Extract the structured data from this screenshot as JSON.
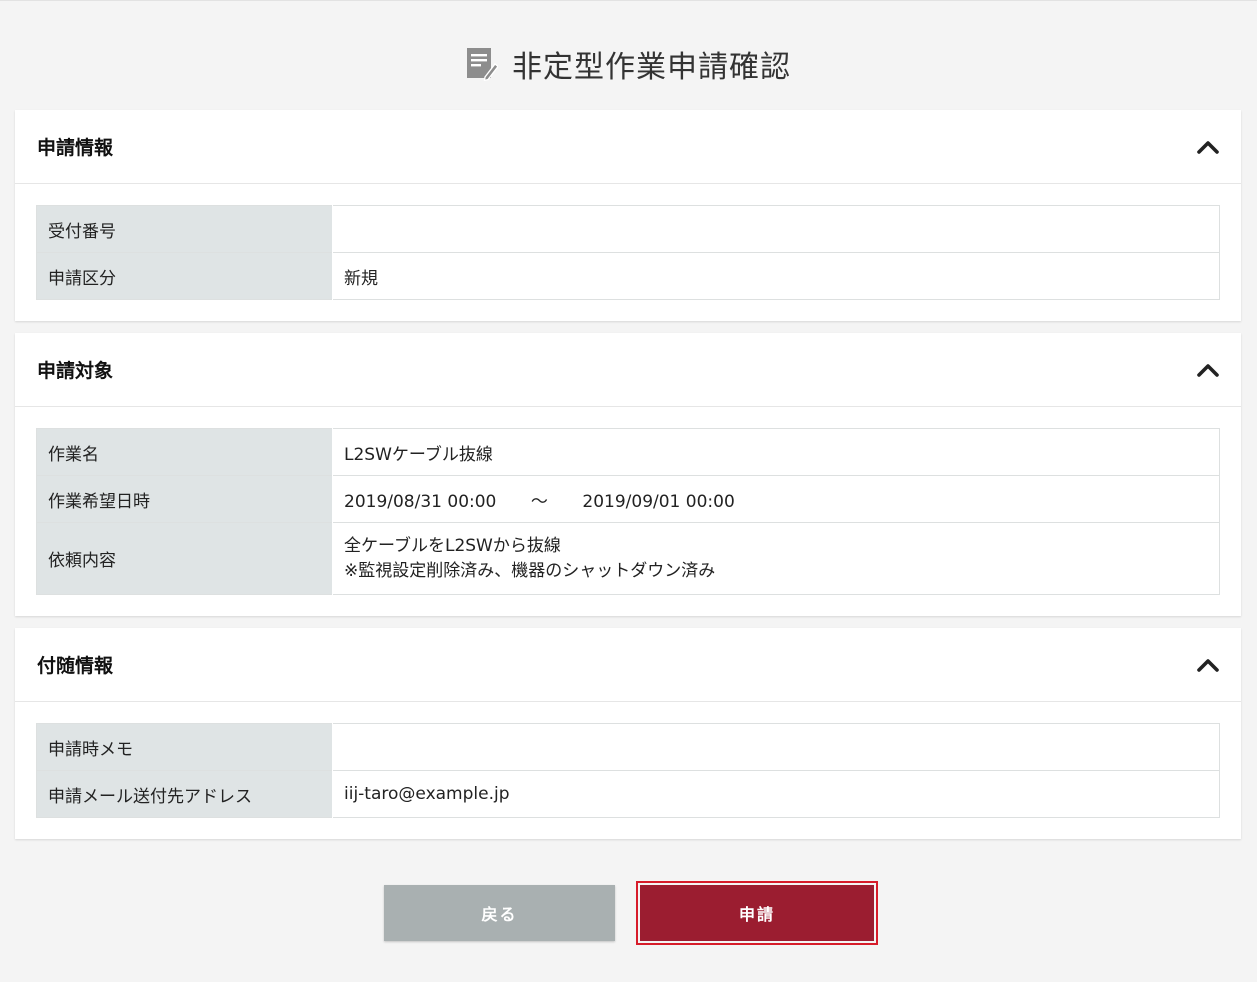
{
  "page": {
    "title": "非定型作業申請確認",
    "title_icon": "document-edit-icon"
  },
  "sections": [
    {
      "title": "申請情報",
      "rows": [
        {
          "label": "受付番号",
          "value": ""
        },
        {
          "label": "申請区分",
          "value": "新規"
        }
      ]
    },
    {
      "title": "申請対象",
      "rows": [
        {
          "label": "作業名",
          "value": "L2SWケーブル抜線"
        },
        {
          "label": "作業希望日時",
          "start": "2019/08/31 00:00",
          "separator": "～",
          "end": "2019/09/01 00:00"
        },
        {
          "label": "依頼内容",
          "lines": [
            "全ケーブルをL2SWから抜線",
            "※監視設定削除済み、機器のシャットダウン済み"
          ]
        }
      ]
    },
    {
      "title": "付随情報",
      "rows": [
        {
          "label": "申請時メモ",
          "value": ""
        },
        {
          "label": "申請メール送付先アドレス",
          "value": "iij-taro@example.jp"
        }
      ]
    }
  ],
  "buttons": {
    "back_label": "戻る",
    "apply_label": "申請"
  },
  "colors": {
    "background": "#f4f4f4",
    "label_cell": "#dfe4e5",
    "back_button": "#a9b0b1",
    "apply_button": "#9b1d30",
    "focus_ring": "#d71c2a"
  }
}
